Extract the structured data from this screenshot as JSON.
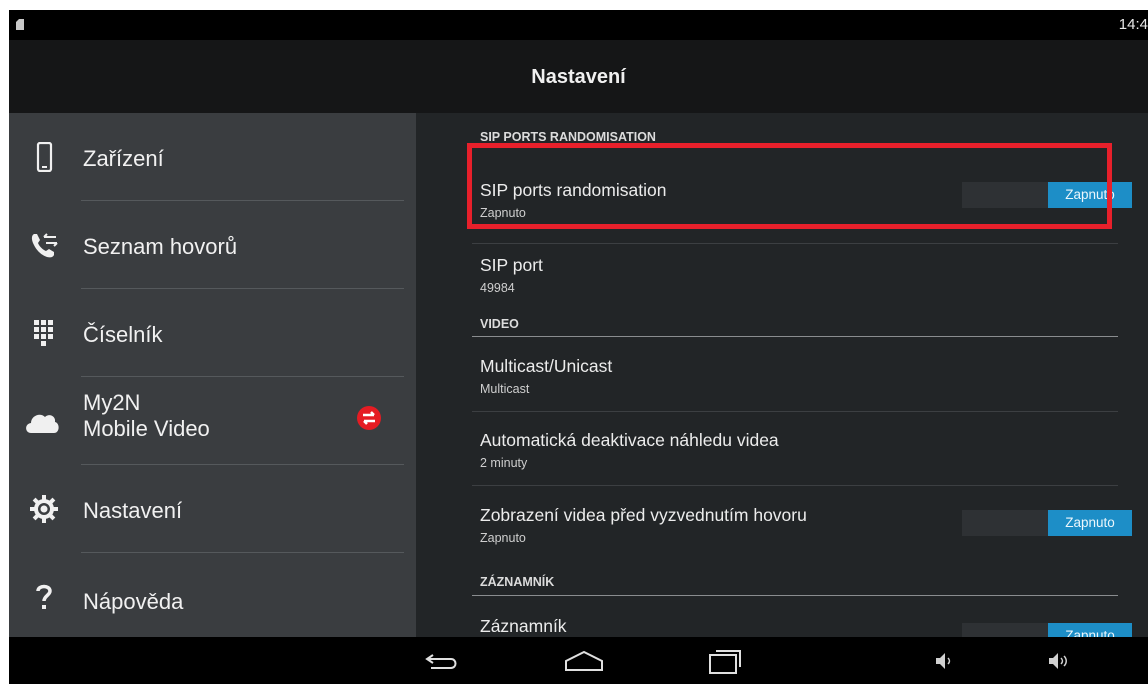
{
  "status_bar": {
    "time": "14:4"
  },
  "action_bar": {
    "title": "Nastavení"
  },
  "sidebar": {
    "items": [
      {
        "label": "Zařízení",
        "icon": "phone-icon"
      },
      {
        "label": "Seznam hovorů",
        "icon": "call-log-icon"
      },
      {
        "label": "Číselník",
        "icon": "dialpad-icon"
      },
      {
        "label_line1": "My2N",
        "label_line2": "Mobile Video",
        "icon": "cloud-icon",
        "badge_icon": "sync-error-badge-icon"
      },
      {
        "label": "Nastavení",
        "icon": "gear-icon"
      },
      {
        "label": "Nápověda",
        "icon": "help-icon"
      }
    ]
  },
  "settings": {
    "section1": {
      "header": "SIP PORTS RANDOMISATION"
    },
    "sip_randomisation": {
      "title": "SIP ports randomisation",
      "summary": "Zapnuto",
      "toggle": "Zapnuto"
    },
    "sip_port": {
      "title": "SIP port",
      "summary": "49984"
    },
    "section2": {
      "header": "VIDEO"
    },
    "multicast": {
      "title": "Multicast/Unicast",
      "summary": "Multicast"
    },
    "auto_deactivate": {
      "title": "Automatická deaktivace náhledu videa",
      "summary": "2 minuty"
    },
    "video_before_answer": {
      "title": "Zobrazení videa před vyzvednutím hovoru",
      "summary": "Zapnuto",
      "toggle": "Zapnuto"
    },
    "section3": {
      "header": "ZÁZNAMNÍK"
    },
    "voicemail": {
      "title": "Záznamník",
      "toggle": "Zapnuto"
    }
  },
  "colors": {
    "accent": "#1d8ec7",
    "highlight": "#e8202b",
    "badge": "#e51c23"
  }
}
